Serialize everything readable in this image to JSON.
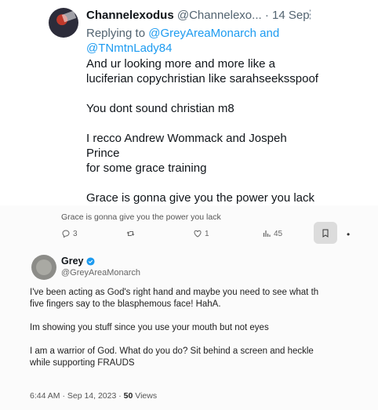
{
  "top_tweet": {
    "name": "Channelexodus",
    "handle": "@Channelexo...",
    "separator": "·",
    "date": "14 Sep",
    "more": "⋮",
    "replying_prefix": "Replying to",
    "mentions": [
      "@GreyAreaMonarch",
      "@TNmtnLady84"
    ],
    "replying_and": "and",
    "paragraphs": [
      [
        "And ur looking more and more like a",
        "luciferian copychristian like sarahseeksspoof"
      ],
      [
        "You dont sound christian m8"
      ],
      [
        "I recco Andrew Wommack and Jospeh Prince",
        "for some grace training"
      ],
      [
        "Grace is gonna give you the power you lack"
      ]
    ]
  },
  "bottom_tweet": {
    "faded_text": "Grace is gonna give you the power you lack",
    "actions": {
      "replies": "3",
      "retweets": "",
      "likes": "1",
      "views": "45"
    },
    "more": "•",
    "name": "Grey",
    "handle": "@GreyAreaMonarch",
    "paragraphs": [
      [
        "I've been acting as God's right hand and maybe you need to see what th",
        "five fingers say to the blasphemous face! HahA."
      ],
      [
        "Im showing you stuff since you use your mouth but not eyes"
      ],
      [
        "I am a warrior of God. What do you do? Sit behind a screen and heckle",
        "while supporting FRAUDS"
      ]
    ],
    "timestamp": "6:44 AM · Sep 14, 2023 · ",
    "views_count": "50",
    "views_label": " Views"
  },
  "colors": {
    "accent": "#1d9bf0",
    "verified": "#1d9bf0",
    "muted": "#536471"
  },
  "icons": [
    "reply-icon",
    "retweet-icon",
    "like-icon",
    "views-icon",
    "bookmark-icon",
    "verified-badge-icon",
    "more-icon"
  ]
}
